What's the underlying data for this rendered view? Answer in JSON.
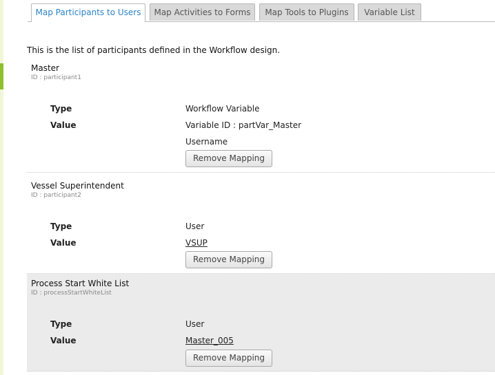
{
  "tabs": [
    {
      "label": "Map Participants to Users",
      "active": true
    },
    {
      "label": "Map Activities to Forms",
      "active": false
    },
    {
      "label": "Map Tools to Plugins",
      "active": false
    },
    {
      "label": "Variable List",
      "active": false
    }
  ],
  "intro": "This is the list of participants defined in the Workflow design.",
  "labels": {
    "type": "Type",
    "value": "Value",
    "remove": "Remove Mapping"
  },
  "participants": [
    {
      "name": "Master",
      "id": "ID : participant1",
      "type": "Workflow Variable",
      "value": "Variable ID : partVar_Master",
      "extra": "Username"
    },
    {
      "name": "Vessel Superintendent",
      "id": "ID : participant2",
      "type": "User",
      "value": "VSUP"
    },
    {
      "name": "Process Start White List",
      "id": "ID : processStartWhiteList",
      "type": "User",
      "value": "Master_005"
    }
  ],
  "colors": {
    "accent": "#2a83c6",
    "sidebar_accent": "#8dbf2e",
    "highlight_row": "#ebebeb"
  }
}
